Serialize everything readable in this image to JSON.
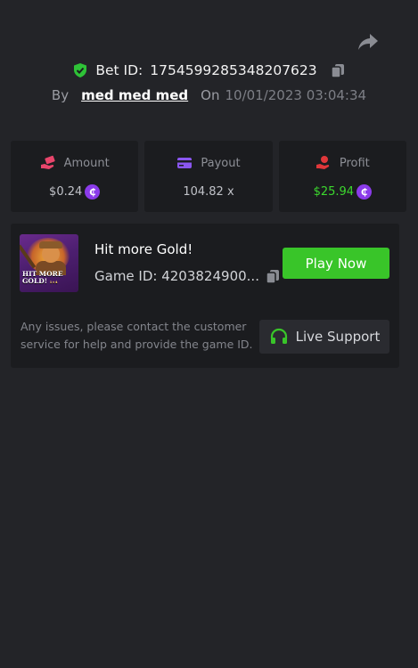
{
  "header": {
    "bet_id_label": "Bet ID:",
    "bet_id": "1754599285348207623",
    "by_label": "By",
    "username": "med med med",
    "on_label": "On",
    "datetime": "10/01/2023 03:04:34"
  },
  "stats": {
    "amount": {
      "label": "Amount",
      "value": "$0.24",
      "icon": "hand-money-icon"
    },
    "payout": {
      "label": "Payout",
      "value": "104.82 x",
      "icon": "card-icon"
    },
    "profit": {
      "label": "Profit",
      "value": "$25.94",
      "icon": "hand-coin-icon"
    },
    "currency_glyph": "₵"
  },
  "game": {
    "title": "Hit more Gold!",
    "game_id": "Game ID: 4203824900...",
    "thumbnail_line1": "HIT MORE",
    "thumbnail_line2": "GOLD!",
    "thumbnail_suffix": "1×4",
    "play_label": "Play Now"
  },
  "support": {
    "notice": "Any issues, please contact the customer service for help and provide the game ID.",
    "button_label": "Live Support"
  },
  "colors": {
    "background": "#232428",
    "card": "#1b1c1f",
    "accent_green": "#39c529",
    "profit_green": "#3cd82e",
    "coin_purple": "#8b3bea",
    "amount_icon": "#e8456b",
    "payout_icon": "#8a56f0",
    "profit_icon": "#e0373a"
  }
}
